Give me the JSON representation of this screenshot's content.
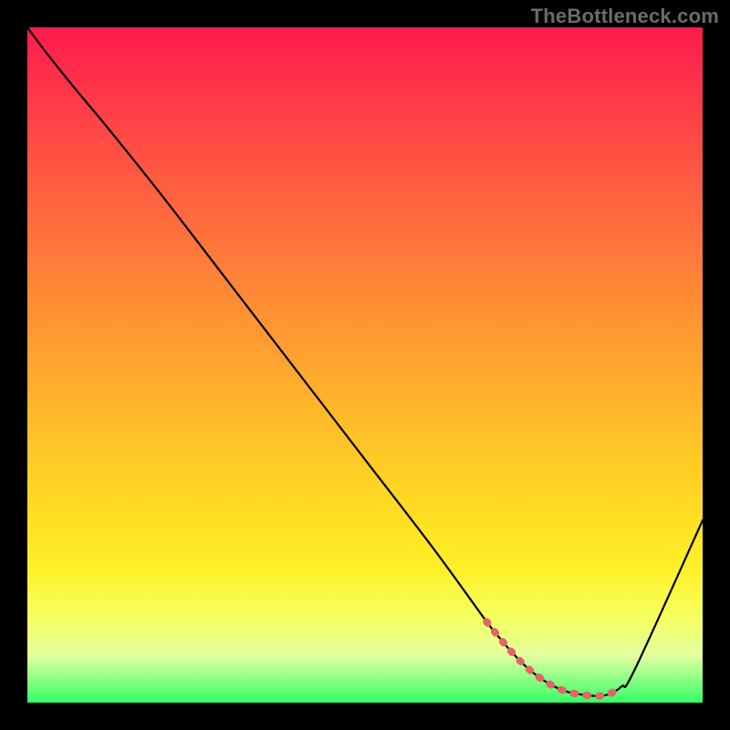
{
  "watermark": "TheBottleneck.com",
  "colors": {
    "background": "#000000",
    "curve": "#000000",
    "highlight": "#e36666",
    "gradient_top": "#ff1a4d",
    "gradient_bottom": "#34ff66"
  },
  "chart_data": {
    "type": "line",
    "title": "",
    "xlabel": "",
    "ylabel": "",
    "xlim": [
      0,
      100
    ],
    "ylim": [
      0,
      100
    ],
    "grid": false,
    "legend": false,
    "series": [
      {
        "name": "bottleneck-curve",
        "x": [
          0,
          3,
          7,
          12,
          20,
          30,
          40,
          50,
          60,
          68,
          70,
          72,
          74,
          76,
          78,
          80,
          82,
          84,
          86,
          88,
          90,
          100
        ],
        "y": [
          100,
          96,
          91,
          85,
          75,
          62,
          49,
          36,
          23,
          12,
          9.5,
          7.2,
          5.2,
          3.6,
          2.4,
          1.6,
          1.2,
          1.0,
          1.2,
          2.4,
          5,
          27
        ]
      }
    ],
    "highlight_region": {
      "name": "minimum-band",
      "x": [
        68,
        70,
        72,
        74,
        76,
        78,
        80,
        82,
        84,
        86,
        88
      ],
      "y": [
        12,
        9.5,
        7.2,
        5.2,
        3.6,
        2.4,
        1.6,
        1.2,
        1.0,
        1.2,
        2.4
      ]
    }
  }
}
